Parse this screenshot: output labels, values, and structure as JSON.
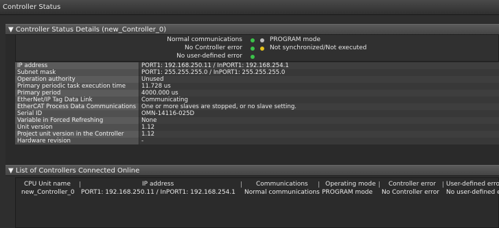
{
  "window": {
    "title": "Controller Status"
  },
  "details": {
    "header": "Controller Status Details (new_Controller_0)",
    "indicators": [
      {
        "label": "Normal communications",
        "color": "#3cc24a",
        "state_color": "#bdbdbd",
        "state_text": "PROGRAM mode"
      },
      {
        "label": "No Controller error",
        "color": "#3cc24a",
        "state_color": "#e6c21a",
        "state_text": "Not synchronized/Not executed"
      },
      {
        "label": "No user-defined error",
        "color": "#3cc24a"
      }
    ],
    "properties": [
      {
        "key": "IP address",
        "value": "PORT1: 192.168.250.11 / InPORT1: 192.168.254.1"
      },
      {
        "key": "Subnet mask",
        "value": "PORT1: 255.255.255.0 / InPORT1: 255.255.255.0"
      },
      {
        "key": "Operation authority",
        "value": "Unused"
      },
      {
        "key": "Primary periodic task execution time",
        "value": "11.728 us"
      },
      {
        "key": "Primary period",
        "value": "4000.000 us"
      },
      {
        "key": "EtherNet/IP Tag Data Link",
        "value": "Communicating"
      },
      {
        "key": "EtherCAT Process Data Communications",
        "value": "One or more slaves are stopped, or no slave setting."
      },
      {
        "key": "Serial ID",
        "value": "OMN-14116-025D"
      },
      {
        "key": "Variable in Forced Refreshing",
        "value": "None"
      },
      {
        "key": "Unit version",
        "value": "1.12"
      },
      {
        "key": "Project unit version in the Controller",
        "value": "1.12"
      },
      {
        "key": "Hardware revision",
        "value": "-"
      }
    ]
  },
  "online": {
    "header": "List of Controllers Connected Online",
    "columns": [
      "CPU Unit name",
      "IP address",
      "Communications",
      "Operating mode",
      "Controller error",
      "User-defined erro"
    ],
    "rows": [
      [
        "new_Controller_0",
        "PORT1: 192.168.250.11 / InPORT1: 192.168.254.1",
        "Normal communications",
        "PROGRAM mode",
        "No Controller error",
        "No user-defined e"
      ]
    ]
  }
}
